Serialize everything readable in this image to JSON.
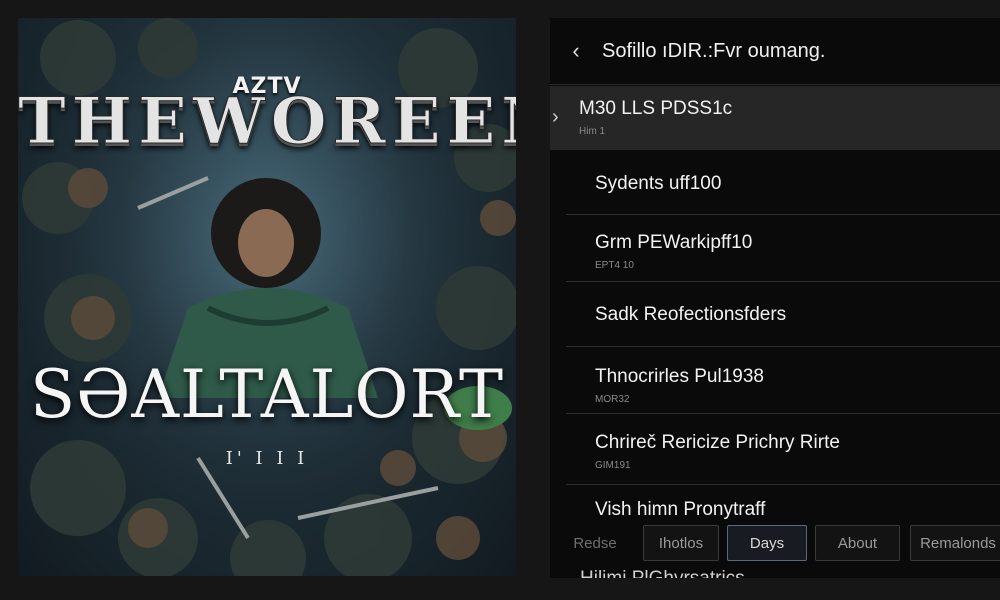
{
  "poster": {
    "small_title": "AZTV",
    "big_title": "THEWOREEM",
    "subtitle": "SƏALTALORT",
    "tagline": "I' I I I"
  },
  "panel": {
    "back_icon": "chevron-left-icon",
    "title": "Sofillo ıDIR.:Fvr oumang.",
    "items": [
      {
        "title": "M30 LLS PDSS1c",
        "meta": "Him 1",
        "selected": true
      },
      {
        "title": "Sydents uff100",
        "meta": ""
      },
      {
        "title": "Grm PEWarkipff10",
        "meta": "EPT4 10"
      },
      {
        "title": "Sadk Reofectionsfders",
        "meta": ""
      },
      {
        "title": "Thnocrirles Pul1938",
        "meta": "MOR32"
      },
      {
        "title": "Chrireč Rericize Prichry Rirte",
        "meta": "GIM191"
      },
      {
        "title": "Vish himn Pronytraff",
        "meta": ""
      }
    ],
    "filters": [
      "Redse",
      "Ihotlos",
      "Days",
      "About",
      "Remalonds"
    ],
    "active_filter": "Days",
    "cut_text": "Hilimi PlGhvrsatrics"
  }
}
